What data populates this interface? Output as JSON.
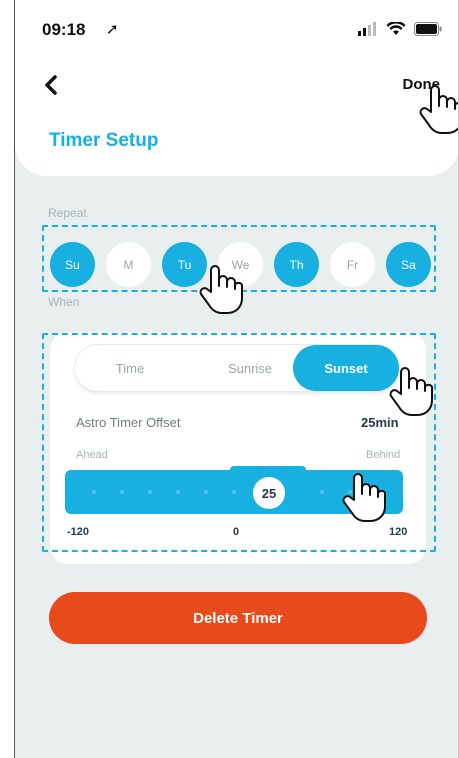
{
  "status_bar": {
    "time": "09:18"
  },
  "header": {
    "done_label": "Done",
    "title": "Timer Setup"
  },
  "repeat": {
    "label": "Repeat",
    "days": [
      {
        "label": "Su",
        "selected": true
      },
      {
        "label": "M",
        "selected": false
      },
      {
        "label": "Tu",
        "selected": true
      },
      {
        "label": "We",
        "selected": false
      },
      {
        "label": "Th",
        "selected": true
      },
      {
        "label": "Fr",
        "selected": false
      },
      {
        "label": "Sa",
        "selected": true
      }
    ]
  },
  "when": {
    "label": "When",
    "modes": [
      "Time",
      "Sunrise",
      "Sunset"
    ],
    "selected_mode": "Sunset",
    "offset_label": "Astro Timer Offset",
    "offset_value": "25min",
    "ahead_label": "Ahead",
    "behind_label": "Behind",
    "slider": {
      "value": "25",
      "min": "-120",
      "mid": "0",
      "max": "120"
    }
  },
  "delete_label": "Delete Timer",
  "colors": {
    "accent": "#17b0e0",
    "danger": "#e84a1b",
    "background": "#e9eeee"
  }
}
